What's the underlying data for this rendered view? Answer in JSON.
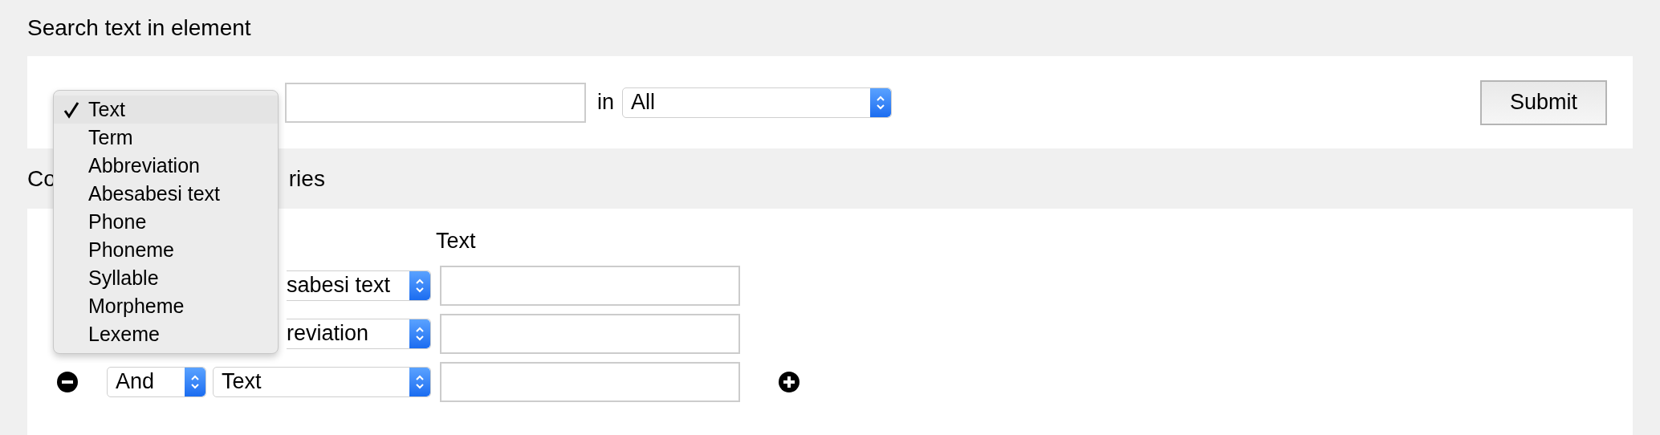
{
  "search_section": {
    "heading": "Search text in element",
    "element_menu": {
      "items": [
        {
          "label": "Text",
          "selected": true
        },
        {
          "label": "Term",
          "selected": false
        },
        {
          "label": "Abbreviation",
          "selected": false
        },
        {
          "label": "Abesabesi text",
          "selected": false
        },
        {
          "label": "Phone",
          "selected": false
        },
        {
          "label": "Phoneme",
          "selected": false
        },
        {
          "label": "Syllable",
          "selected": false
        },
        {
          "label": "Morpheme",
          "selected": false
        },
        {
          "label": "Lexeme",
          "selected": false
        }
      ]
    },
    "in_label": "in",
    "scope_select": {
      "value": "All"
    },
    "submit": "Submit"
  },
  "complex_section": {
    "heading_parts": [
      "Co",
      "ries"
    ],
    "column_label": "Text",
    "rows": [
      {
        "element_value": "sabesi text",
        "add_button": false
      },
      {
        "element_value": "reviation",
        "add_button": false
      },
      {
        "operator": "And",
        "element_value": "Text",
        "remove_button": true,
        "add_button": true
      }
    ]
  }
}
